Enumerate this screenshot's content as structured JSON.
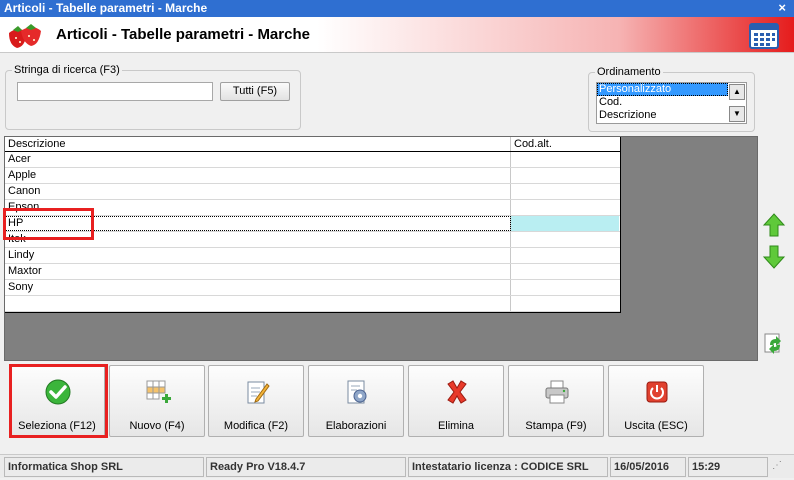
{
  "window": {
    "title": "Articoli - Tabelle parametri - Marche",
    "close_label": "×"
  },
  "header": {
    "title": "Articoli - Tabelle parametri - Marche"
  },
  "search": {
    "label": "Stringa di ricerca (F3)",
    "value": "",
    "all_button": "Tutti (F5)"
  },
  "ordering": {
    "label": "Ordinamento",
    "options": [
      "Personalizzato",
      "Cod.",
      "Descrizione"
    ],
    "selected": "Personalizzato"
  },
  "table": {
    "columns": [
      "Descrizione",
      "Cod.alt."
    ],
    "rows": [
      {
        "descrizione": "Acer",
        "cod_alt": ""
      },
      {
        "descrizione": "Apple",
        "cod_alt": ""
      },
      {
        "descrizione": "Canon",
        "cod_alt": ""
      },
      {
        "descrizione": "Epson",
        "cod_alt": ""
      },
      {
        "descrizione": "HP",
        "cod_alt": ""
      },
      {
        "descrizione": "Itek",
        "cod_alt": ""
      },
      {
        "descrizione": "Lindy",
        "cod_alt": ""
      },
      {
        "descrizione": "Maxtor",
        "cod_alt": ""
      },
      {
        "descrizione": "Sony",
        "cod_alt": ""
      },
      {
        "descrizione": "",
        "cod_alt": ""
      }
    ],
    "selected_row": "HP"
  },
  "toolbar": {
    "seleziona": "Seleziona (F12)",
    "nuovo": "Nuovo (F4)",
    "modifica": "Modifica (F2)",
    "elaborazioni": "Elaborazioni",
    "elimina": "Elimina",
    "stampa": "Stampa (F9)",
    "uscita": "Uscita (ESC)"
  },
  "status": {
    "company": "Informatica Shop SRL",
    "version": "Ready Pro V18.4.7",
    "license": "Intestatario licenza : CODICE SRL",
    "date": "16/05/2016",
    "time": "15:29"
  },
  "colors": {
    "accent_red": "#e51c1c",
    "selection_blue": "#3399ff",
    "highlight": "#e82020",
    "cod_alt_selected": "#b9eef2"
  }
}
